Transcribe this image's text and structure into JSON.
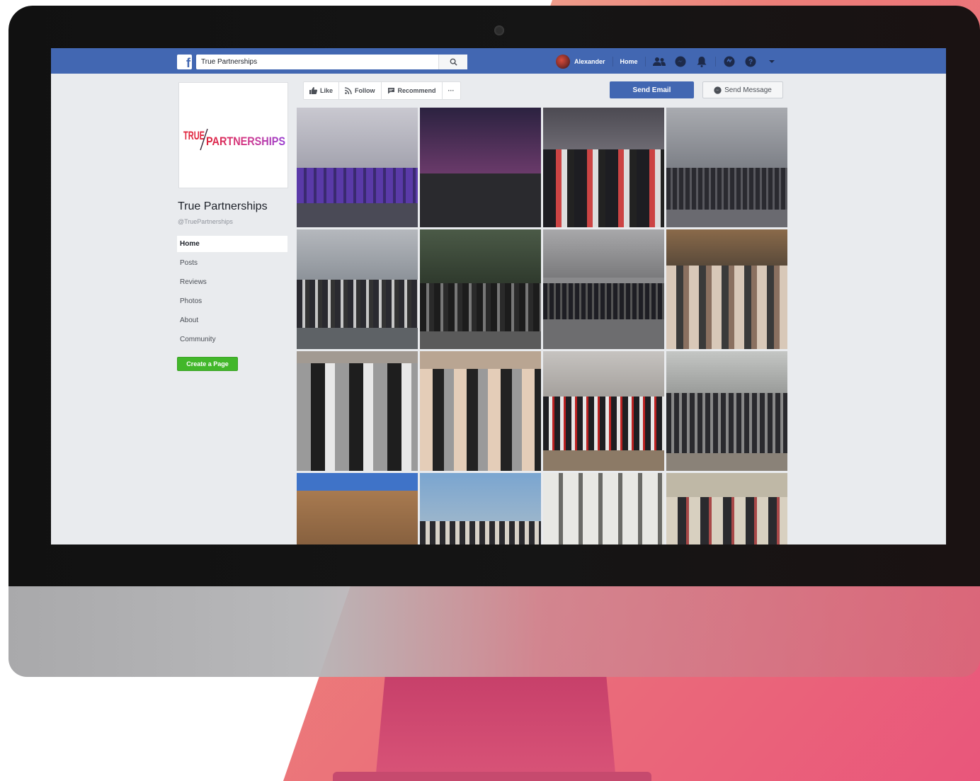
{
  "page": {
    "search_value": "True Partnerships",
    "nav": {
      "user_name": "Alexander",
      "home_label": "Home"
    },
    "page_title": "True Partnerships",
    "page_handle": "@TruePartnerships",
    "logo": {
      "word1": "TRUE",
      "word2": "PARTNERSHIPS"
    },
    "side_nav": [
      "Home",
      "Posts",
      "Reviews",
      "Photos",
      "About",
      "Community"
    ],
    "active_side_index": 0,
    "create_page_label": "Create a Page",
    "actions": {
      "like": "Like",
      "follow": "Follow",
      "recommend": "Recommend",
      "more": "···",
      "send_email": "Send Email",
      "send_message": "Send Message"
    },
    "photo_count": 16
  },
  "colors": {
    "fb_blue": "#4267b2",
    "page_bg": "#e9ebee",
    "create_green": "#42b72a",
    "logo_red": "#e0243c",
    "logo_purple": "#9b3fd1"
  }
}
